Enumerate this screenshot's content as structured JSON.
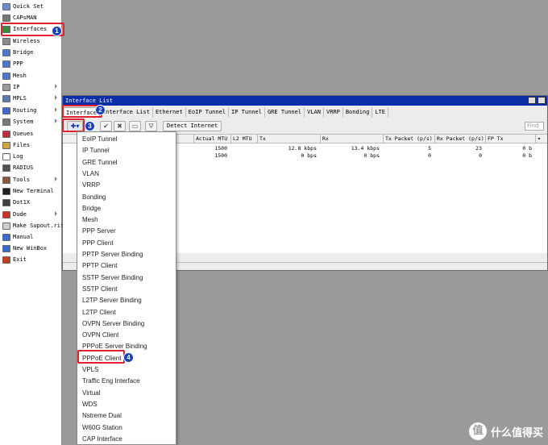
{
  "sidebar": {
    "items": [
      {
        "label": "Quick Set",
        "icon": "wand-icon",
        "color": "#6a8fd0",
        "submenu": false
      },
      {
        "label": "CAPsMAN",
        "icon": "antenna-icon",
        "color": "#777777",
        "submenu": false
      },
      {
        "label": "Interfaces",
        "icon": "interfaces-icon",
        "color": "#3c8a3c",
        "submenu": false
      },
      {
        "label": "Wireless",
        "icon": "wireless-icon",
        "color": "#8a8a8a",
        "submenu": false
      },
      {
        "label": "Bridge",
        "icon": "bridge-icon",
        "color": "#4a7ad0",
        "submenu": false
      },
      {
        "label": "PPP",
        "icon": "ppp-icon",
        "color": "#4a7ad0",
        "submenu": false
      },
      {
        "label": "Mesh",
        "icon": "mesh-icon",
        "color": "#4a7ad0",
        "submenu": false
      },
      {
        "label": "IP",
        "icon": "ip-icon",
        "color": "#9a9a9a",
        "submenu": true
      },
      {
        "label": "MPLS",
        "icon": "mpls-icon",
        "color": "#5a7ab0",
        "submenu": true
      },
      {
        "label": "Routing",
        "icon": "routing-icon",
        "color": "#3c6ad0",
        "submenu": true
      },
      {
        "label": "System",
        "icon": "gear-icon",
        "color": "#7a7a7a",
        "submenu": true
      },
      {
        "label": "Queues",
        "icon": "queues-icon",
        "color": "#c0303a",
        "submenu": false
      },
      {
        "label": "Files",
        "icon": "files-icon",
        "color": "#d0a840",
        "submenu": false
      },
      {
        "label": "Log",
        "icon": "log-icon",
        "color": "#ffffff",
        "submenu": false
      },
      {
        "label": "RADIUS",
        "icon": "radius-icon",
        "color": "#505050",
        "submenu": false
      },
      {
        "label": "Tools",
        "icon": "tools-icon",
        "color": "#8a5a3a",
        "submenu": true
      },
      {
        "label": "New Terminal",
        "icon": "terminal-icon",
        "color": "#202020",
        "submenu": false
      },
      {
        "label": "Dot1X",
        "icon": "dot1x-icon",
        "color": "#404040",
        "submenu": false
      },
      {
        "label": "Dude",
        "icon": "dude-icon",
        "color": "#d03020",
        "submenu": true
      },
      {
        "label": "Make Supout.rif",
        "icon": "supout-icon",
        "color": "#d0d0d0",
        "submenu": false
      },
      {
        "label": "Manual",
        "icon": "manual-icon",
        "color": "#3a6ad0",
        "submenu": false
      },
      {
        "label": "New WinBox",
        "icon": "winbox-icon",
        "color": "#3a6ad0",
        "submenu": false
      },
      {
        "label": "Exit",
        "icon": "exit-icon",
        "color": "#c04020",
        "submenu": false
      }
    ]
  },
  "window": {
    "title": "Interface List",
    "tabs": [
      "Interface",
      "Interface List",
      "Ethernet",
      "EoIP Tunnel",
      "IP Tunnel",
      "GRE Tunnel",
      "VLAN",
      "VRRP",
      "Bonding",
      "LTE"
    ],
    "detect_label": "Detect Internet",
    "find_placeholder": "Find",
    "columns": [
      "Actual MTU",
      "L2 MTU",
      "Tx",
      "Rx",
      "Tx Packet (p/s)",
      "Rx Packet (p/s)",
      "FP Tx"
    ],
    "rows": [
      {
        "actual_mtu": "1500",
        "l2_mtu": "",
        "tx": "12.8 kbps",
        "rx": "13.4 kbps",
        "tx_packet": "5",
        "rx_packet": "23",
        "fp_tx": "0 b"
      },
      {
        "actual_mtu": "1500",
        "l2_mtu": "",
        "tx": "0 bps",
        "rx": "0 bps",
        "tx_packet": "0",
        "rx_packet": "0",
        "fp_tx": "0 b"
      }
    ]
  },
  "menu": {
    "items": [
      "EoIP Tunnel",
      "IP Tunnel",
      "GRE Tunnel",
      "VLAN",
      "VRRP",
      "Bonding",
      "Bridge",
      "Mesh",
      "PPP Server",
      "PPP Client",
      "PPTP Server Binding",
      "PPTP Client",
      "SSTP Server Binding",
      "SSTP Client",
      "L2TP Server Binding",
      "L2TP Client",
      "OVPN Server Binding",
      "OVPN Client",
      "PPPoE Server Binding",
      "PPPoE Client",
      "VPLS",
      "Traffic Eng Interface",
      "Virtual",
      "WDS",
      "Nstreme Dual",
      "W60G Station",
      "CAP Interface"
    ],
    "highlighted": "PPPoE Client"
  },
  "badges": [
    "1",
    "2",
    "3",
    "4"
  ],
  "watermark": {
    "text": "什么值得买",
    "logo": "值"
  }
}
